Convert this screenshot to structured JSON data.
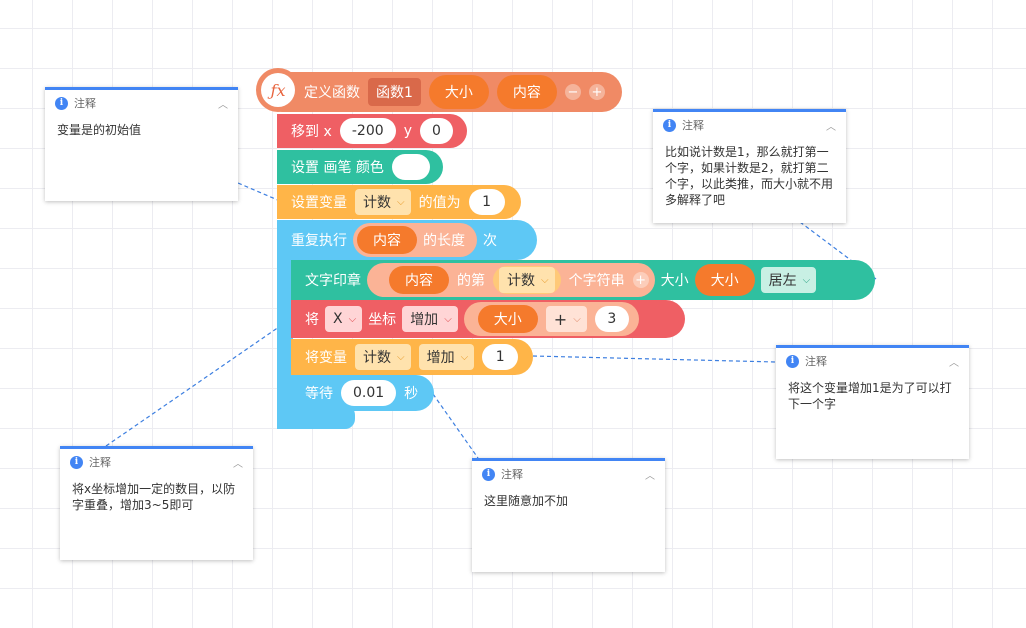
{
  "colors": {
    "define_block": "#f08a65",
    "motion_block": "#ef5f64",
    "pen_block": "#2fc0a0",
    "variable_block": "#ffb548",
    "control_block": "#5ec8f5",
    "reporter_orange": "#f57a2c",
    "comment_accent": "#4285f4"
  },
  "define_block": {
    "icon": "fx-icon",
    "label": "定义函数",
    "func_name": "函数1",
    "param1": "大小",
    "param2": "内容",
    "minus": "−",
    "plus": "+"
  },
  "move_block": {
    "label": "移到 x",
    "x_value": "-200",
    "y_label": "y",
    "y_value": "0"
  },
  "pen_block": {
    "label": "设置 画笔 颜色"
  },
  "setvar_block": {
    "label": "设置变量",
    "var": "计数",
    "label2": "的值为",
    "value": "1"
  },
  "repeat_block": {
    "label": "重复执行",
    "param": "内容",
    "label2": "的长度",
    "label3": "次"
  },
  "stamp_block": {
    "label": "文字印章",
    "param": "内容",
    "label2": "的第",
    "var": "计数",
    "label3": "个字符串",
    "plus": "+",
    "label4": "大小",
    "size_param": "大小",
    "align": "居左"
  },
  "change_coord_block": {
    "label": "将",
    "axis": "X",
    "label2": "坐标",
    "op": "增加",
    "param": "大小",
    "operator": "+",
    "value": "3"
  },
  "change_var_block": {
    "label": "将变量",
    "var": "计数",
    "op": "增加",
    "value": "1"
  },
  "wait_block": {
    "label": "等待",
    "value": "0.01",
    "unit": "秒"
  },
  "comments": [
    {
      "title": "注释",
      "text": "变量是的初始值"
    },
    {
      "title": "注释",
      "text": "比如说计数是1，那么就打第一个字，如果计数是2，就打第二个字，以此类推，而大小就不用多解释了吧"
    },
    {
      "title": "注释",
      "text": "将这个变量增加1是为了可以打下一个字"
    },
    {
      "title": "注释",
      "text": "将x坐标增加一定的数目，以防字重叠，增加3~5即可"
    },
    {
      "title": "注释",
      "text": "这里随意加不加"
    }
  ]
}
